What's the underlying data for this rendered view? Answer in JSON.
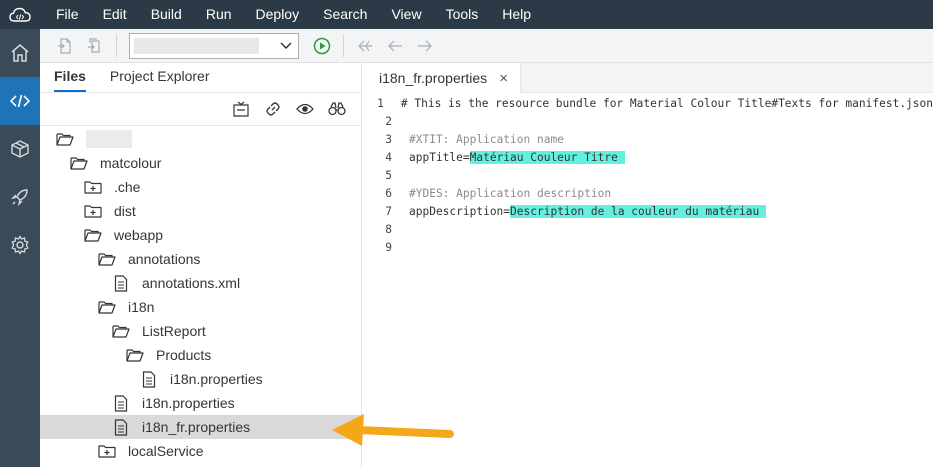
{
  "menubar": {
    "items": [
      "File",
      "Edit",
      "Build",
      "Run",
      "Deploy",
      "Search",
      "View",
      "Tools",
      "Help"
    ]
  },
  "activitybar": {
    "items": [
      "home-icon",
      "code-icon",
      "cube-icon",
      "rocket-icon",
      "gear-icon"
    ],
    "active": "code-icon"
  },
  "toolbar": {
    "run_config_value": "",
    "icons": [
      "new-file-icon",
      "duplicate-icon",
      "run-icon",
      "back-all-icon",
      "back-icon",
      "forward-icon"
    ]
  },
  "leftpanel": {
    "tabs": [
      "Files",
      "Project Explorer"
    ],
    "active_tab": "Files",
    "tree": [
      {
        "label": "",
        "depth": 0,
        "icon": "folder-open-icon"
      },
      {
        "label": "matcolour",
        "depth": 1,
        "icon": "folder-open-icon"
      },
      {
        "label": ".che",
        "depth": 2,
        "icon": "folder-plus-icon"
      },
      {
        "label": "dist",
        "depth": 2,
        "icon": "folder-plus-icon"
      },
      {
        "label": "webapp",
        "depth": 2,
        "icon": "folder-open-icon"
      },
      {
        "label": "annotations",
        "depth": 3,
        "icon": "folder-open-icon"
      },
      {
        "label": "annotations.xml",
        "depth": 4,
        "icon": "file-icon"
      },
      {
        "label": "i18n",
        "depth": 3,
        "icon": "folder-open-icon"
      },
      {
        "label": "ListReport",
        "depth": 4,
        "icon": "folder-open-icon"
      },
      {
        "label": "Products",
        "depth": 5,
        "icon": "folder-open-icon"
      },
      {
        "label": "i18n.properties",
        "depth": 6,
        "icon": "file-icon"
      },
      {
        "label": "i18n.properties",
        "depth": 4,
        "icon": "file-icon"
      },
      {
        "label": "i18n_fr.properties",
        "depth": 4,
        "icon": "file-icon",
        "selected": true
      },
      {
        "label": "localService",
        "depth": 3,
        "icon": "folder-plus-icon"
      }
    ]
  },
  "editor": {
    "tab_label": "i18n_fr.properties",
    "tab_close": "×",
    "lines": [
      {
        "n": "1",
        "parts": [
          {
            "t": "# This is the resource bundle for Material Colour Title#Texts for manifest.json",
            "c": ""
          }
        ]
      },
      {
        "n": "2",
        "parts": []
      },
      {
        "n": "3",
        "parts": [
          {
            "t": "#XTIT: Application name",
            "c": "cmt"
          }
        ]
      },
      {
        "n": "4",
        "parts": [
          {
            "t": "appTitle=",
            "c": ""
          },
          {
            "t": "Matériau Couleur Titre ",
            "c": "hl"
          }
        ]
      },
      {
        "n": "5",
        "parts": []
      },
      {
        "n": "6",
        "parts": [
          {
            "t": "#YDES: Application description",
            "c": "cmt"
          }
        ]
      },
      {
        "n": "7",
        "parts": [
          {
            "t": "appDescription=",
            "c": ""
          },
          {
            "t": "Description de la couleur du matériau ",
            "c": "hl"
          }
        ]
      },
      {
        "n": "8",
        "parts": []
      },
      {
        "n": "9",
        "parts": []
      }
    ]
  },
  "colors": {
    "menubar_bg": "#2c3a47",
    "activity_bg": "#3a4a59",
    "activity_active": "#1f73b7",
    "highlight": "#64f0e0",
    "arrow": "#f5a71a"
  }
}
